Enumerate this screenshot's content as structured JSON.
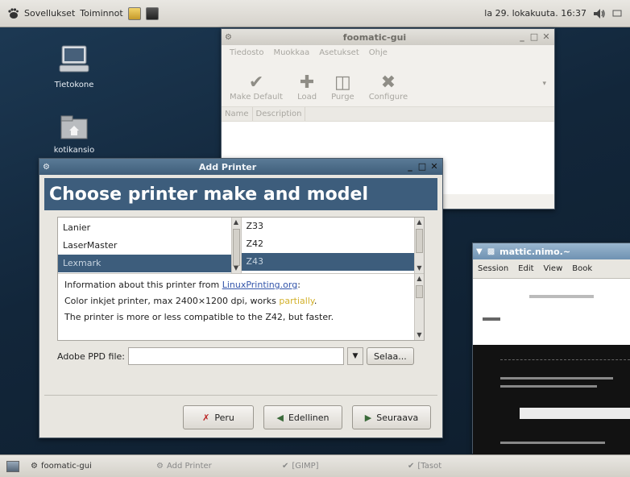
{
  "top_panel": {
    "menu_applications": "Sovellukset",
    "menu_actions": "Toiminnot",
    "clock": "la 29. lokakuuta. 16:37"
  },
  "desktop": {
    "icon_computer": "Tietokone",
    "icon_home": "kotikansio"
  },
  "foomatic_window": {
    "title": "foomatic-gui",
    "menu": [
      "Tiedosto",
      "Muokkaa",
      "Asetukset",
      "Ohje"
    ],
    "toolbar": {
      "make_default": "Make Default",
      "load": "Load",
      "purge": "Purge",
      "configure": "Configure"
    },
    "columns": [
      "Name",
      "Description"
    ]
  },
  "add_printer": {
    "title": "Add Printer",
    "heading": "Choose printer make and model",
    "makes": [
      "Lanier",
      "LaserMaster",
      "Lexmark"
    ],
    "models": [
      "Z33",
      "Z42",
      "Z43"
    ],
    "info_prefix": "Information about this printer from ",
    "info_link": "LinuxPrinting.org",
    "info_suffix": ":",
    "info_line2_prefix": "Color inkjet printer, max 2400×1200 dpi, works ",
    "info_line2_status": "partially",
    "info_line2_suffix": ".",
    "info_line3": "The printer is more or less compatible to the Z42, but faster.",
    "ppd_label": "Adobe PPD file:",
    "browse": "Selaa...",
    "cancel": "Peru",
    "back": "Edellinen",
    "next": "Seuraava"
  },
  "terminal_window": {
    "title": "mattic.nimo.~",
    "menu": [
      "Session",
      "Edit",
      "View",
      "Book"
    ]
  },
  "taskbar": {
    "tasks": [
      "foomatic-gui",
      "Add Printer",
      "[GIMP]",
      "[Tasot"
    ]
  }
}
